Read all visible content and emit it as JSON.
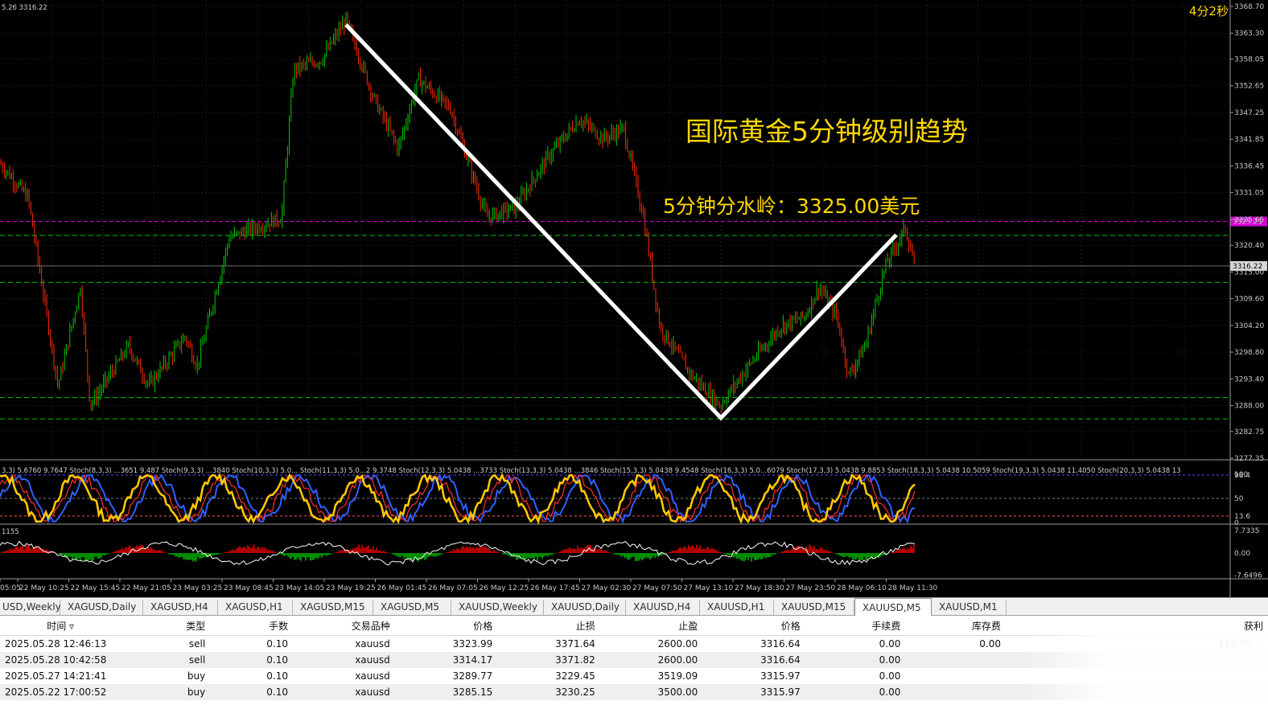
{
  "chart_data": {
    "type": "candlestick",
    "symbol_header": "5.26 3316.22",
    "timer": "4分2秒",
    "y_ticks": [
      "3368.70",
      "3363.30",
      "3358.05",
      "3352.65",
      "3347.25",
      "3341.85",
      "3336.45",
      "3331.05",
      "3325.65",
      "3320.40",
      "3315.00",
      "3309.60",
      "3304.20",
      "3298.80",
      "3293.40",
      "3288.00",
      "3282.75",
      "3277.35"
    ],
    "ylim": [
      3277.35,
      3368.7
    ],
    "price_labels": {
      "magenta": "3325.21",
      "current": "3316.22"
    },
    "x_ticks": [
      "05:05",
      "22 May 10:25",
      "22 May 15:45",
      "22 May 21:05",
      "23 May 03:25",
      "23 May 08:45",
      "23 May 14:05",
      "23 May 19:25",
      "26 May 01:45",
      "26 May 07:05",
      "26 May 12:25",
      "26 May 17:45",
      "27 May 02:30",
      "27 May 07:50",
      "27 May 13:10",
      "27 May 18:30",
      "27 May 23:50",
      "28 May 06:10",
      "28 May 11:30"
    ],
    "trend_line_points": [
      3365.0,
      3285.5,
      3322.5
    ],
    "annotation_title": "国际黄金5分钟级别趋势",
    "annotation_level": "5分钟分水岭：3325.00美元",
    "stoch_header": "3,3) 5.6760 9.7647  Stoch(8,3,3) ...3651 9.487  Stoch(9,3,3) ...3840  Stoch(10,3,3) 5.0...  Stoch(11,3,3) 5.0...2 9.3748  Stoch(12,3,3) 5.0438 ...3733  Stoch(13,3,3) 5.0438 ...3846  Stoch(15,3,3) 5.0438 9.4548  Stoch(16,3,3) 5.0...6079  Stoch(17,3,3) 5.0438 9.8853  Stoch(18,3,3) 5.0438 10.5059  Stoch(19,3,3) 5.0438 11.4050  Stoch(20,3,3) 5.0438 13",
    "stoch_ticks": [
      "100",
      "98.4",
      "50",
      "13.6",
      "0"
    ],
    "macd_header": "1155",
    "macd_ticks": [
      "7.7335",
      "0.00",
      "-7.6496"
    ]
  },
  "tabs": [
    "USD,Weekly",
    "XAGUSD,Daily",
    "XAGUSD,H4",
    "XAGUSD,H1",
    "XAGUSD,M15",
    "XAGUSD,M5",
    "XAUUSD,Weekly",
    "XAUUSD,Daily",
    "XAUUSD,H4",
    "XAUUSD,H1",
    "XAUUSD,M15",
    "XAUUSD,M5",
    "XAUUSD,M1"
  ],
  "active_tab": "XAUUSD,M5",
  "table": {
    "headers": [
      "时间",
      "类型",
      "手数",
      "交易品种",
      "价格",
      "止损",
      "止盈",
      "价格",
      "手续费",
      "库存费",
      "获利"
    ],
    "rows": [
      [
        "2025.05.28 12:46:13",
        "sell",
        "0.10",
        "xauusd",
        "3323.99",
        "3371.64",
        "2600.00",
        "3316.64",
        "0.00",
        "0.00",
        "113.99"
      ],
      [
        "2025.05.28 10:42:58",
        "sell",
        "0.10",
        "xauusd",
        "3314.17",
        "3371.82",
        "2600.00",
        "3316.64",
        "0.00",
        "",
        ""
      ],
      [
        "2025.05.27 14:21:41",
        "buy",
        "0.10",
        "xauusd",
        "3289.77",
        "3229.45",
        "3519.09",
        "3315.97",
        "0.00",
        "",
        ""
      ],
      [
        "2025.05.22 17:00:52",
        "buy",
        "0.10",
        "xauusd",
        "3285.15",
        "3230.25",
        "3500.00",
        "3315.97",
        "0.00",
        "",
        ""
      ]
    ]
  },
  "colors": {
    "bull": "#00c800",
    "bear": "#ff2a00",
    "grid": "#1a1a1a",
    "dashed": "#00c800",
    "magenta": "#d200d2",
    "annotation": "#ffd700",
    "stoch_main": "#ffc800"
  }
}
